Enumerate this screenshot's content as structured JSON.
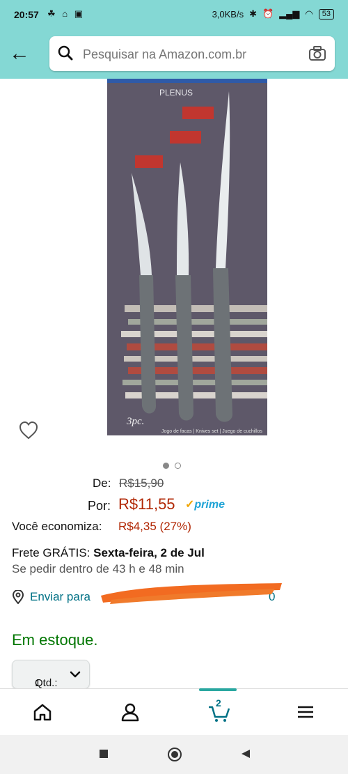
{
  "status_bar": {
    "time": "20:57",
    "speed": "3,0KB/s",
    "battery": "53"
  },
  "search": {
    "placeholder": "Pesquisar na Amazon.com.br"
  },
  "product_image": {
    "brand_text": "PLENUS",
    "pack_label": "3pc.",
    "pack_caption": "Jogo de facas | Knives set | Juego de cuchillos"
  },
  "carousel": {
    "count": 2,
    "active_index": 0
  },
  "pricing": {
    "list_label": "De:",
    "list_price": "R$15,90",
    "price_label": "Por:",
    "price": "R$11,55",
    "prime": "prime",
    "savings_label": "Você economiza:",
    "savings": "R$4,35 (27%)"
  },
  "delivery": {
    "frete_prefix": "Frete GRÁTIS:",
    "frete_date": "Sexta-feira, 2 de Jul",
    "order_within": "Se pedir dentro de 43 h e 48 min",
    "ship_to": "Enviar para",
    "ship_to_tail": "0"
  },
  "stock": "Em estoque.",
  "quantity": {
    "label": "Qtd.:",
    "value": "1"
  },
  "nav": {
    "cart_count": "2"
  },
  "colors": {
    "accent": "#84d8d4",
    "price_red": "#b12704",
    "link": "#007185",
    "stock_green": "#007600",
    "prime_blue": "#1ea3d6"
  }
}
